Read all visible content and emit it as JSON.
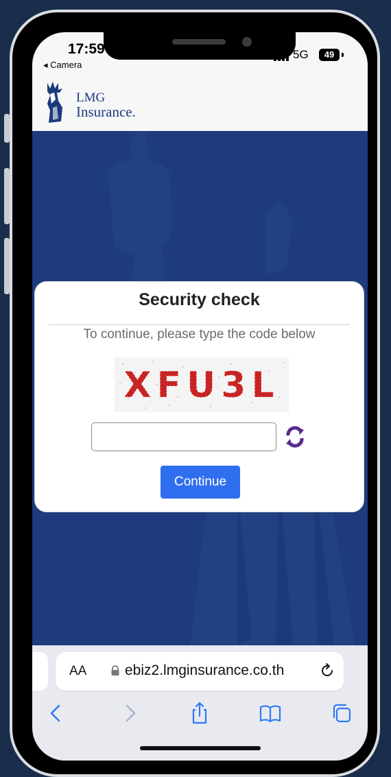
{
  "status_bar": {
    "time": "17:59",
    "back_app": "◂ Camera",
    "network": "5G",
    "battery": "49"
  },
  "brand": {
    "name_line1": "LMG",
    "name_line2": "Insurance."
  },
  "modal": {
    "title": "Security check",
    "subtitle": "To continue, please type the code below",
    "captcha_code": "XFU3L",
    "input_value": "",
    "continue_label": "Continue"
  },
  "browser": {
    "text_size_label": "AA",
    "url": "ebiz2.lmginsurance.co.th"
  },
  "colors": {
    "hero_blue": "#1d3b7d",
    "button_blue": "#2f6fef",
    "captcha_red": "#c82424",
    "refresh_purple": "#5a2a8c",
    "ios_blue": "#2f7af7"
  },
  "icons": [
    "lock-icon",
    "reload-icon",
    "back-icon",
    "forward-icon",
    "share-icon",
    "bookmarks-icon",
    "tabs-icon",
    "refresh-captcha-icon"
  ]
}
